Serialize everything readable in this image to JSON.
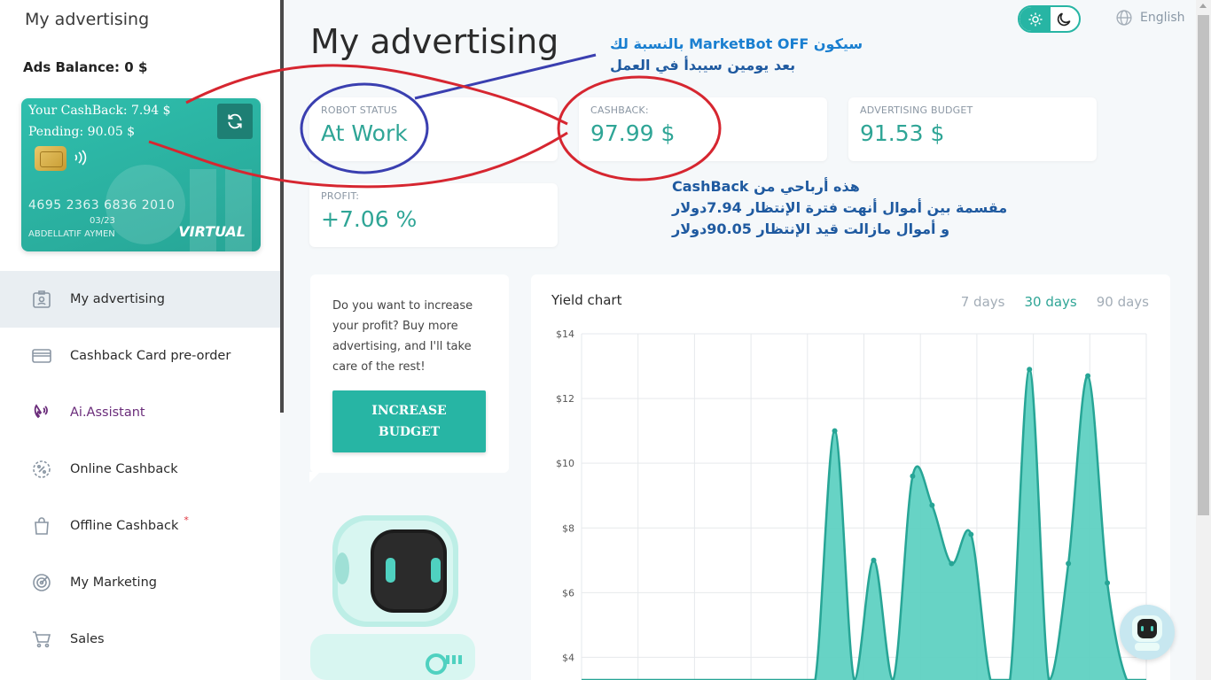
{
  "sidebar": {
    "title": "My advertising",
    "ads_balance": "Ads Balance: 0 $",
    "card": {
      "cashback_line": "Your CashBack: 7.94 $",
      "pending_line": "Pending: 90.05 $",
      "number": "4695 2363 6836 2010",
      "expiry": "03/23",
      "holder": "ABDELLATIF AYMEN",
      "type": "VIRTUAL"
    },
    "items": [
      {
        "label": "My advertising",
        "icon": "id-badge-icon",
        "active": true
      },
      {
        "label": "Cashback Card pre-order",
        "icon": "credit-card-icon"
      },
      {
        "label": "Ai.Assistant",
        "icon": "phone-wave-icon"
      },
      {
        "label": "Online Cashback",
        "icon": "percent-gear-icon"
      },
      {
        "label": "Offline Cashback",
        "icon": "shopping-bag-icon",
        "badge": "*"
      },
      {
        "label": "My Marketing",
        "icon": "target-icon"
      },
      {
        "label": "Sales",
        "icon": "cart-icon"
      }
    ]
  },
  "header": {
    "title": "My advertising",
    "language": "English"
  },
  "stats": {
    "robot_status": {
      "label": "ROBOT STATUS",
      "value": "At Work"
    },
    "cashback": {
      "label": "CASHBACK:",
      "value": "97.99 $"
    },
    "advertising_budget": {
      "label": "ADVERTISING BUDGET",
      "value": "91.53 $"
    },
    "profit": {
      "label": "PROFIT:",
      "value": "+7.06 %"
    }
  },
  "promo": {
    "text": "Do you want to increase your profit? Buy more advertising, and I'll take care of the rest!",
    "button_line1": "INCREASE",
    "button_line2": "BUDGET"
  },
  "chart": {
    "title": "Yield chart",
    "ranges": [
      "7 days",
      "30 days",
      "90 days"
    ],
    "active_range": "30 days",
    "accent": "#5fd1c2",
    "line_color": "#27a596"
  },
  "chart_data": {
    "type": "area",
    "title": "Yield chart",
    "xlabel": "",
    "ylabel": "",
    "ylim": [
      3.3,
      14
    ],
    "yticks": [
      "$14",
      "$12",
      "$10",
      "$8",
      "$6",
      "$4"
    ],
    "ytick_values": [
      14,
      12,
      10,
      8,
      6,
      4
    ],
    "x": [
      0,
      1,
      2,
      3,
      4,
      5,
      6,
      7,
      8,
      9,
      10,
      11,
      12,
      13,
      14,
      15,
      16,
      17,
      18,
      19,
      20,
      21,
      22,
      23,
      24,
      25,
      26,
      27,
      28,
      29
    ],
    "values": [
      3.3,
      3.3,
      3.3,
      3.3,
      3.3,
      3.3,
      3.3,
      3.3,
      3.3,
      3.3,
      3.3,
      3.3,
      3.3,
      11.0,
      3.3,
      7.0,
      3.3,
      9.6,
      8.7,
      6.9,
      7.8,
      3.3,
      3.3,
      12.9,
      3.3,
      6.9,
      12.7,
      6.3,
      3.3,
      3.3
    ],
    "grid": true
  },
  "annotations": {
    "note1_line1": "سيكون MarketBot OFF بالنسبة لك",
    "note1_line2": "بعد يومين سيبدأ في العمل",
    "note2_line1": "هذه أرباحي من CashBack",
    "note2_line2": "مقسمة بين أموال أنهت فترة الإنتظار 7.94دولار",
    "note2_line3": "و أموال مازالت قيد الإنتظار 90.05دولار",
    "red_color": "#d62630",
    "blue_color": "#3a3fb0"
  }
}
